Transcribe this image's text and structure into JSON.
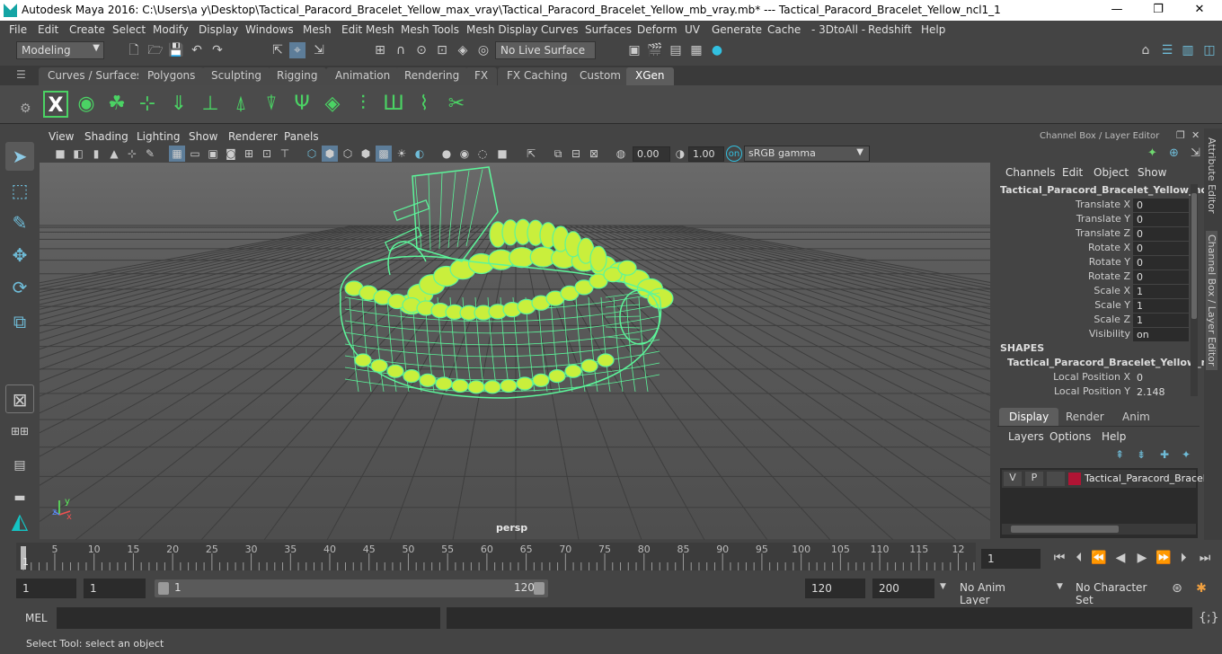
{
  "window": {
    "title": "Autodesk Maya 2016: C:\\Users\\a y\\Desktop\\Tactical_Paracord_Bracelet_Yellow_max_vray\\Tactical_Paracord_Bracelet_Yellow_mb_vray.mb*   ---   Tactical_Paracord_Bracelet_Yellow_ncl1_1",
    "minimize": "—",
    "maximize": "❐",
    "close": "✕"
  },
  "menubar": [
    "File",
    "Edit",
    "Create",
    "Select",
    "Modify",
    "Display",
    "Windows",
    "Mesh",
    "Edit Mesh",
    "Mesh Tools",
    "Mesh Display",
    "Curves",
    "Surfaces",
    "Deform",
    "UV",
    "Generate",
    "Cache",
    "- 3DtoAll -",
    "Redshift",
    "Help"
  ],
  "statusline": {
    "mode": "Modeling",
    "live_surface": "No Live Surface"
  },
  "shelf": {
    "tabs": [
      "Curves / Surfaces",
      "Polygons",
      "Sculpting",
      "Rigging",
      "Animation",
      "Rendering",
      "FX",
      "FX Caching",
      "Custom",
      "XGen"
    ],
    "active_tab": "XGen",
    "icons": [
      "xgen-x-icon",
      "xgen-eye-icon",
      "xgen-leaf-icon",
      "xgen-add-guide-icon",
      "xgen-sculpt-guide-icon",
      "xgen-add-point-icon",
      "xgen-hair-icon",
      "xgen-groom-icon",
      "xgen-lock-icon",
      "xgen-fur-icon",
      "xgen-layer-icon",
      "xgen-comb-icon",
      "xgen-cut-icon",
      "xgen-curve-icon",
      "xgen-delete-icon"
    ]
  },
  "viewport": {
    "menus": [
      "View",
      "Shading",
      "Lighting",
      "Show",
      "Renderer",
      "Panels"
    ],
    "exposure": "0.00",
    "gamma": "1.00",
    "color_space": "sRGB gamma",
    "camera_label": "persp",
    "axis_x": "x",
    "axis_y": "y",
    "axis_z": "z",
    "wire_color": "#5cf59a",
    "fill_color": "#c9ef3c"
  },
  "channel_box": {
    "header": "Channel Box / Layer Editor",
    "menus": [
      "Channels",
      "Edit",
      "Object",
      "Show"
    ],
    "object_name": "Tactical_Paracord_Bracelet_Yellow_ncl...",
    "attributes": [
      {
        "label": "Translate X",
        "value": "0"
      },
      {
        "label": "Translate Y",
        "value": "0"
      },
      {
        "label": "Translate Z",
        "value": "0"
      },
      {
        "label": "Rotate X",
        "value": "0"
      },
      {
        "label": "Rotate Y",
        "value": "0"
      },
      {
        "label": "Rotate Z",
        "value": "0"
      },
      {
        "label": "Scale X",
        "value": "1"
      },
      {
        "label": "Scale Y",
        "value": "1"
      },
      {
        "label": "Scale Z",
        "value": "1"
      },
      {
        "label": "Visibility",
        "value": "on"
      }
    ],
    "shapes_header": "SHAPES",
    "shape_name": "Tactical_Paracord_Bracelet_Yellow_n...",
    "shape_attributes": [
      {
        "label": "Local Position X",
        "value": "0"
      },
      {
        "label": "Local Position Y",
        "value": "2.148"
      }
    ]
  },
  "layer_editor": {
    "tabs": [
      "Display",
      "Render",
      "Anim"
    ],
    "active_tab": "Display",
    "menus": [
      "Layers",
      "Options",
      "Help"
    ],
    "layer": {
      "v": "V",
      "p": "P",
      "name": "Tactical_Paracord_Bracelet",
      "color": "#b01434"
    }
  },
  "side_tabs": [
    "Attribute Editor",
    "Channel Box / Layer Editor"
  ],
  "timeline": {
    "ticks": [
      "5",
      "10",
      "15",
      "20",
      "25",
      "30",
      "35",
      "40",
      "45",
      "50",
      "55",
      "60",
      "65",
      "70",
      "75",
      "80",
      "85",
      "90",
      "95",
      "100",
      "105",
      "110",
      "115",
      "12"
    ],
    "start_marker": "1",
    "current_frame": "1"
  },
  "range": {
    "start": "1",
    "anim_start": "1",
    "slider_start": "1",
    "slider_end": "120",
    "end": "120",
    "anim_end": "200",
    "anim_layer": "No Anim Layer",
    "char_set": "No Character Set"
  },
  "command": {
    "label": "MEL"
  },
  "help_line": "Select Tool: select an object"
}
